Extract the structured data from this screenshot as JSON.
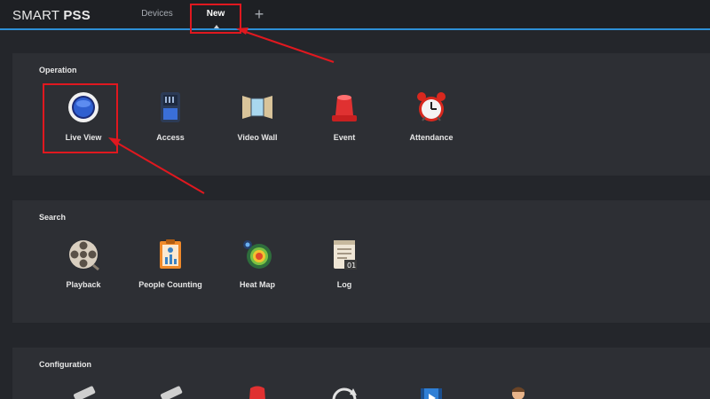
{
  "app": {
    "brand_prefix": "SMART",
    "brand_suffix": "PSS"
  },
  "tabs": {
    "devices": "Devices",
    "new": "New",
    "add": "+"
  },
  "sections": {
    "operation": {
      "title": "Operation",
      "items": [
        {
          "label": "Live View",
          "icon": "live-view-icon"
        },
        {
          "label": "Access",
          "icon": "access-icon"
        },
        {
          "label": "Video Wall",
          "icon": "video-wall-icon"
        },
        {
          "label": "Event",
          "icon": "event-icon"
        },
        {
          "label": "Attendance",
          "icon": "alarm-clock-icon"
        }
      ]
    },
    "search": {
      "title": "Search",
      "items": [
        {
          "label": "Playback",
          "icon": "film-reel-icon"
        },
        {
          "label": "People Counting",
          "icon": "people-counting-icon"
        },
        {
          "label": "Heat Map",
          "icon": "heat-map-icon"
        },
        {
          "label": "Log",
          "icon": "log-icon"
        }
      ]
    },
    "configuration": {
      "title": "Configuration",
      "icons": [
        "device-config-icon",
        "tools-icon",
        "event-config-icon",
        "sync-icon",
        "video-tour-icon",
        "user-icon"
      ]
    }
  },
  "colors": {
    "accent": "#2d8fd6",
    "highlight": "#e0181f",
    "panel": "#2d2f34",
    "background": "#24262b"
  }
}
